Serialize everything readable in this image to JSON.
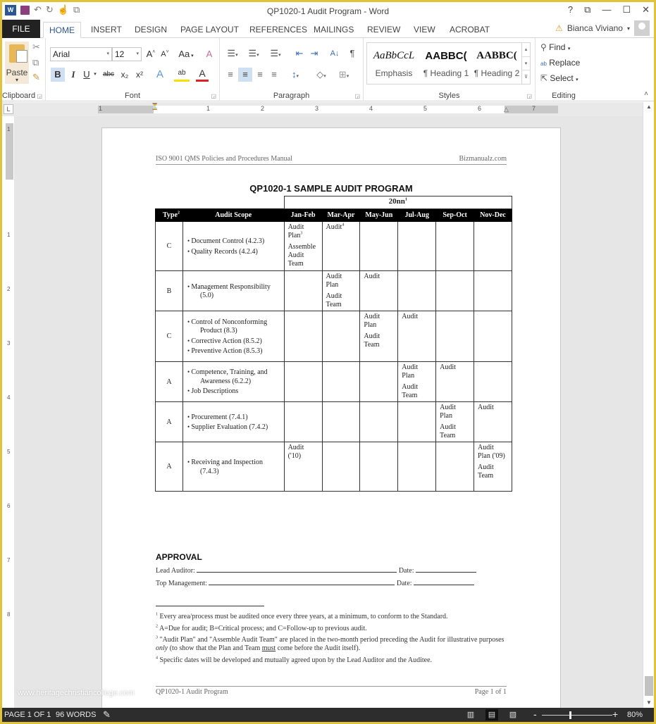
{
  "app": {
    "title": "QP1020-1 Audit Program - Word",
    "quick_access": {
      "app_icon": "word-logo-icon",
      "app_icon_text": "W",
      "save": "save-icon",
      "undo": "undo-icon",
      "redo": "redo-icon",
      "touch": "touch-mode-icon",
      "customize": "customize-icon"
    },
    "window_controls": {
      "help": "?",
      "ribbon_options": "⧉",
      "minimize": "—",
      "maximize": "☐",
      "close": "✕"
    },
    "user": {
      "name": "Bianca Viviano",
      "warning": "⚠",
      "dropdown": "▾"
    }
  },
  "tabs": [
    {
      "label": "FILE"
    },
    {
      "label": "HOME",
      "active": true
    },
    {
      "label": "INSERT"
    },
    {
      "label": "DESIGN"
    },
    {
      "label": "PAGE LAYOUT"
    },
    {
      "label": "REFERENCES"
    },
    {
      "label": "MAILINGS"
    },
    {
      "label": "REVIEW"
    },
    {
      "label": "VIEW"
    },
    {
      "label": "ACROBAT"
    }
  ],
  "ribbon": {
    "clipboard": {
      "label": "Clipboard",
      "paste": "Paste",
      "paste_arrow": "▾",
      "cut": "✂",
      "copy": "⧉",
      "format_painter": "🖌"
    },
    "font": {
      "label": "Font",
      "font_name": "Arial",
      "font_size": "12",
      "grow": "A˄",
      "shrink": "A˅",
      "change_case": "Aa",
      "clear": "A",
      "bold": "B",
      "italic": "I",
      "underline": "U",
      "strike": "abc",
      "subscript": "x₂",
      "superscript": "x²",
      "text_effects": "A",
      "highlight": "ab",
      "font_color": "A",
      "highlight_color": "#f5e000",
      "font_color_value": "#e02020"
    },
    "paragraph": {
      "label": "Paragraph",
      "bullets": "☰",
      "numbering": "☰",
      "multilevel": "☰",
      "decrease_indent": "⇤",
      "increase_indent": "⇥",
      "sort": "A↓",
      "show_marks": "¶",
      "align_left": "≡",
      "center": "≡",
      "align_right": "≡",
      "justify": "≡",
      "line_spacing": "↕",
      "shading": "◇",
      "borders": "⊞"
    },
    "styles": {
      "label": "Styles",
      "items": [
        {
          "sample": "AaBbCcL",
          "name": "Emphasis"
        },
        {
          "sample": "AABBC(",
          "name": "¶ Heading 1"
        },
        {
          "sample": "AABBC(",
          "name": "¶ Heading 2"
        }
      ],
      "scroll_up": "▴",
      "scroll_down": "▾",
      "more": "⊽"
    },
    "editing": {
      "label": "Editing",
      "find": "Find",
      "replace": "Replace",
      "select": "Select",
      "find_icon": "🔭",
      "replace_icon": "ab→ac",
      "select_icon": "⇱"
    },
    "collapse": "˄"
  },
  "ruler": {
    "tab_selector": "L",
    "numbers": [
      "1",
      "1",
      "2",
      "3",
      "4",
      "5",
      "6",
      "7"
    ],
    "vertical_numbers": [
      "1",
      "1",
      "2",
      "3",
      "4",
      "5",
      "6",
      "7",
      "8"
    ]
  },
  "document": {
    "header_left": "ISO 9001 QMS Policies and Procedures Manual",
    "header_right": "Bizmanualz.com",
    "title": "QP1020-1 SAMPLE AUDIT PROGRAM",
    "table": {
      "year_label": "20nn",
      "year_sup": "1",
      "headers": {
        "type": "Type",
        "type_sup": "2",
        "scope": "Audit Scope",
        "months": [
          "Jan-Feb",
          "Mar-Apr",
          "May-Jun",
          "Jul-Aug",
          "Sep-Oct",
          "Nov-Dec"
        ]
      },
      "rows": [
        {
          "type": "C",
          "scope": [
            {
              "main": "Document Control (4.2.3)"
            },
            {
              "main": "Quality Records (4.2.4)"
            }
          ],
          "cells": [
            [
              {
                "text": "Audit Plan",
                "sup": "3"
              },
              {
                "text": "Assemble Audit Team"
              }
            ],
            [
              {
                "text": "Audit",
                "sup": "4"
              }
            ],
            [],
            [],
            [],
            []
          ]
        },
        {
          "type": "B",
          "scope": [
            {
              "main": "Management Responsibility",
              "cont": "(5.0)"
            }
          ],
          "cells": [
            [],
            [
              {
                "text": "Audit Plan"
              },
              {
                "text": "Audit Team"
              }
            ],
            [
              {
                "text": "Audit"
              }
            ],
            [],
            [],
            []
          ]
        },
        {
          "type": "C",
          "scope": [
            {
              "main": "Control of Nonconforming",
              "cont": "Product (8.3)"
            },
            {
              "main": "Corrective Action (8.5.2)"
            },
            {
              "main": "Preventive Action (8.5.3)"
            }
          ],
          "cells": [
            [],
            [],
            [
              {
                "text": "Audit Plan"
              },
              {
                "text": "Audit Team"
              }
            ],
            [
              {
                "text": "Audit"
              }
            ],
            [],
            []
          ]
        },
        {
          "type": "A",
          "scope": [
            {
              "main": "Competence, Training, and",
              "cont": "Awareness (6.2.2)"
            },
            {
              "main": "Job Descriptions"
            }
          ],
          "cells": [
            [],
            [],
            [],
            [
              {
                "text": "Audit Plan"
              },
              {
                "text": "Audit Team"
              }
            ],
            [
              {
                "text": "Audit"
              }
            ],
            []
          ]
        },
        {
          "type": "A",
          "scope": [
            {
              "main": "Procurement (7.4.1)"
            },
            {
              "main": "Supplier Evaluation (7.4.2)"
            }
          ],
          "cells": [
            [],
            [],
            [],
            [],
            [
              {
                "text": "Audit Plan"
              },
              {
                "text": "Audit Team"
              }
            ],
            [
              {
                "text": "Audit"
              }
            ]
          ]
        },
        {
          "type": "A",
          "scope": [
            {
              "main": "Receiving and Inspection",
              "cont": "(7.4.3)"
            }
          ],
          "cells": [
            [
              {
                "text": "Audit ('10)"
              }
            ],
            [],
            [],
            [],
            [],
            [
              {
                "text": "Audit Plan ('09)"
              },
              {
                "text": "Audit Team"
              }
            ]
          ]
        }
      ]
    },
    "approval": {
      "heading": "APPROVAL",
      "lead_auditor": "Lead Auditor:",
      "top_management": "Top Management:",
      "date": "Date:"
    },
    "footnotes": [
      {
        "num": "1",
        "text": "Every area/process must be audited once every three years, at a minimum, to conform to the Standard."
      },
      {
        "num": "2",
        "text": "A=Due for audit; B=Critical process; and C=Follow-up to previous audit."
      },
      {
        "num": "3",
        "text_before": "\"Audit Plan\" and \"Assemble Audit Team\" are placed in the two-month period preceding the Audit for illustrative purposes ",
        "italic": "only",
        "text_mid": " (to show that the Plan and Team ",
        "underline": "must",
        "text_after": " come before the Audit itself)."
      },
      {
        "num": "4",
        "text": "Specific dates will be developed and mutually agreed upon by the Lead Auditor and the Auditee."
      }
    ],
    "footer_left": "QP1020-1 Audit Program",
    "footer_right": "Page 1 of 1"
  },
  "watermark": "www.heritagechristiancollege.com",
  "statusbar": {
    "page": "PAGE 1 OF 1",
    "words": "96 WORDS",
    "proofing_icon": "✎",
    "read_mode": "▥",
    "print_layout": "▤",
    "web_layout": "▧",
    "zoom_out": "-",
    "zoom_in": "+",
    "zoom_level": "80%",
    "zoom_percent": 80
  },
  "scrollbar": {
    "up": "▲",
    "down": "▼"
  }
}
